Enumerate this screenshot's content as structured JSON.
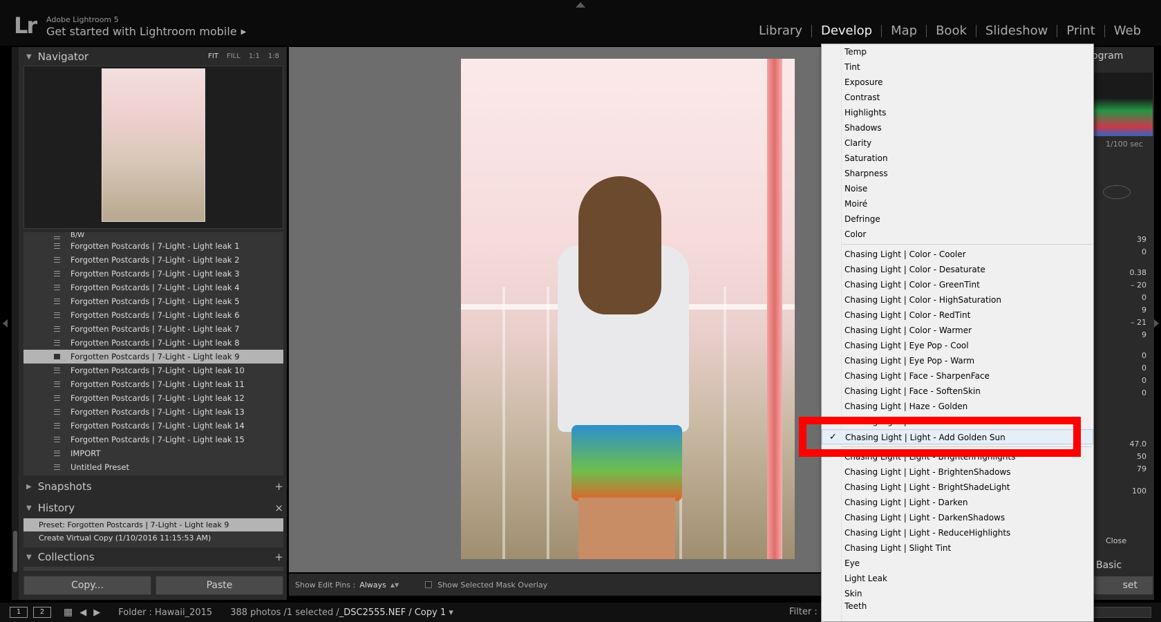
{
  "topbar": {
    "logo": "Lr",
    "app_name": "Adobe Lightroom 5",
    "mobile_link": "Get started with Lightroom mobile",
    "modules": [
      "Library",
      "Develop",
      "Map",
      "Book",
      "Slideshow",
      "Print",
      "Web"
    ],
    "active_module": "Develop"
  },
  "left_panel": {
    "navigator": {
      "title": "Navigator",
      "zoom": [
        "FIT",
        "FILL",
        "1:1",
        "1:8"
      ]
    },
    "presets": {
      "partial_top": "B/W",
      "items": [
        "Forgotten Postcards | 7-Light - Light leak 1",
        "Forgotten Postcards | 7-Light - Light leak 2",
        "Forgotten Postcards | 7-Light - Light leak 3",
        "Forgotten Postcards | 7-Light - Light leak 4",
        "Forgotten Postcards | 7-Light - Light leak 5",
        "Forgotten Postcards | 7-Light - Light leak 6",
        "Forgotten Postcards | 7-Light - Light leak 7",
        "Forgotten Postcards | 7-Light - Light leak 8",
        "Forgotten Postcards | 7-Light - Light leak 9",
        "Forgotten Postcards | 7-Light - Light leak 10",
        "Forgotten Postcards | 7-Light - Light leak 11",
        "Forgotten Postcards | 7-Light - Light leak 12",
        "Forgotten Postcards | 7-Light - Light leak 13",
        "Forgotten Postcards | 7-Light - Light leak 14",
        "Forgotten Postcards | 7-Light - Light leak 15",
        "IMPORT",
        "Untitled Preset"
      ],
      "selected_index": 8
    },
    "snapshots": {
      "title": "Snapshots",
      "action": "+"
    },
    "history": {
      "title": "History",
      "action": "×",
      "items": [
        "Preset: Forgotten Postcards | 7-Light - Light leak 9",
        "Create Virtual Copy (1/10/2016 11:15:53 AM)"
      ]
    },
    "collections": {
      "title": "Collections",
      "action": "+"
    },
    "copy_label": "Copy...",
    "paste_label": "Paste"
  },
  "canvas_toolbar": {
    "edit_pins_label": "Show Edit Pins :",
    "edit_pins_value": "Always",
    "mask_overlay_label": "Show Selected Mask Overlay"
  },
  "right_panel": {
    "histogram_label": "ogram",
    "shutter": "1/100 sec",
    "values": [
      "39",
      "0",
      "0.38",
      "– 20",
      "0",
      "9",
      "– 21",
      "9",
      "0",
      "0",
      "0",
      "0",
      "47.0",
      "50",
      "79",
      "100"
    ],
    "close_label": "Close",
    "basic_label": "Basic",
    "reset_label": "set"
  },
  "menu": {
    "group1": [
      "Temp",
      "Tint",
      "Exposure",
      "Contrast",
      "Highlights",
      "Shadows",
      "Clarity",
      "Saturation",
      "Sharpness",
      "Noise",
      "Moiré",
      "Defringe",
      "Color"
    ],
    "group2": [
      "Chasing Light | Color - Cooler",
      "Chasing Light | Color - Desaturate",
      "Chasing Light | Color - GreenTint",
      "Chasing Light | Color - HighSaturation",
      "Chasing Light | Color - RedTint",
      "Chasing Light | Color - Warmer",
      "Chasing Light | Eye Pop - Cool",
      "Chasing Light | Eye Pop - Warm",
      "Chasing Light | Face - SharpenFace",
      "Chasing Light | Face - SoftenSkin",
      "Chasing Light | Haze - Golden",
      "Chasing Light | Haze - NeutralHaze"
    ],
    "checked_item": "Chasing Light | Light - Add Golden Sun",
    "checkmark": "✓",
    "group3": [
      "Chasing Light | Light - BrightenHighlights",
      "Chasing Light | Light - BrightenShadows",
      "Chasing Light | Light - BrightShadeLight",
      "Chasing Light | Light - Darken",
      "Chasing Light | Light - DarkenShadows",
      "Chasing Light | Light - ReduceHighlights",
      "Chasing Light | Slight Tint",
      "Eye",
      "Light Leak",
      "Skin",
      "Teeth"
    ]
  },
  "filmstrip_bar": {
    "screen1": "1",
    "screen2": "2",
    "folder": "Folder : Hawaii_2015",
    "count": "388 photos /1 selected /",
    "filename": "_DSC2555.NEF / Copy 1",
    "filter_label": "Filter :"
  },
  "colors": {
    "highlight": "#ff0000",
    "active_module": "#f2f2f2",
    "selected_row": "#b4b4b4"
  }
}
